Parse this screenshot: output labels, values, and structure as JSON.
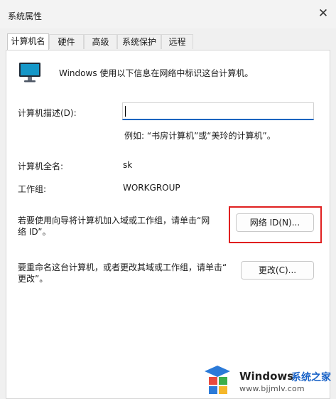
{
  "window": {
    "title": "系统属性"
  },
  "tabs": [
    {
      "label": "计算机名"
    },
    {
      "label": "硬件"
    },
    {
      "label": "高级"
    },
    {
      "label": "系统保护"
    },
    {
      "label": "远程"
    }
  ],
  "intro": {
    "text": "Windows 使用以下信息在网络中标识这台计算机。"
  },
  "description": {
    "label": "计算机描述(D):",
    "value": "",
    "example": "例如: “书房计算机”或“美玲的计算机”。"
  },
  "full_name": {
    "label": "计算机全名:",
    "value": "sk"
  },
  "workgroup": {
    "label": "工作组:",
    "value": "WORKGROUP"
  },
  "network_id": {
    "text_line1": "若要使用向导将计算机加入域或工作组，请单击“网",
    "text_line2": "络 ID”。",
    "button": "网络 ID(N)..."
  },
  "rename": {
    "text_line1": "要重命名这台计算机，或者更改其域或工作组，请单击“",
    "text_line2": "更改”。",
    "button": "更改(C)..."
  },
  "watermark": {
    "brand": "Windows",
    "cn": "系统之家",
    "url": "www.bjjmlv.com"
  },
  "colors": {
    "highlight": "#e02020",
    "accent": "#1464c0"
  }
}
